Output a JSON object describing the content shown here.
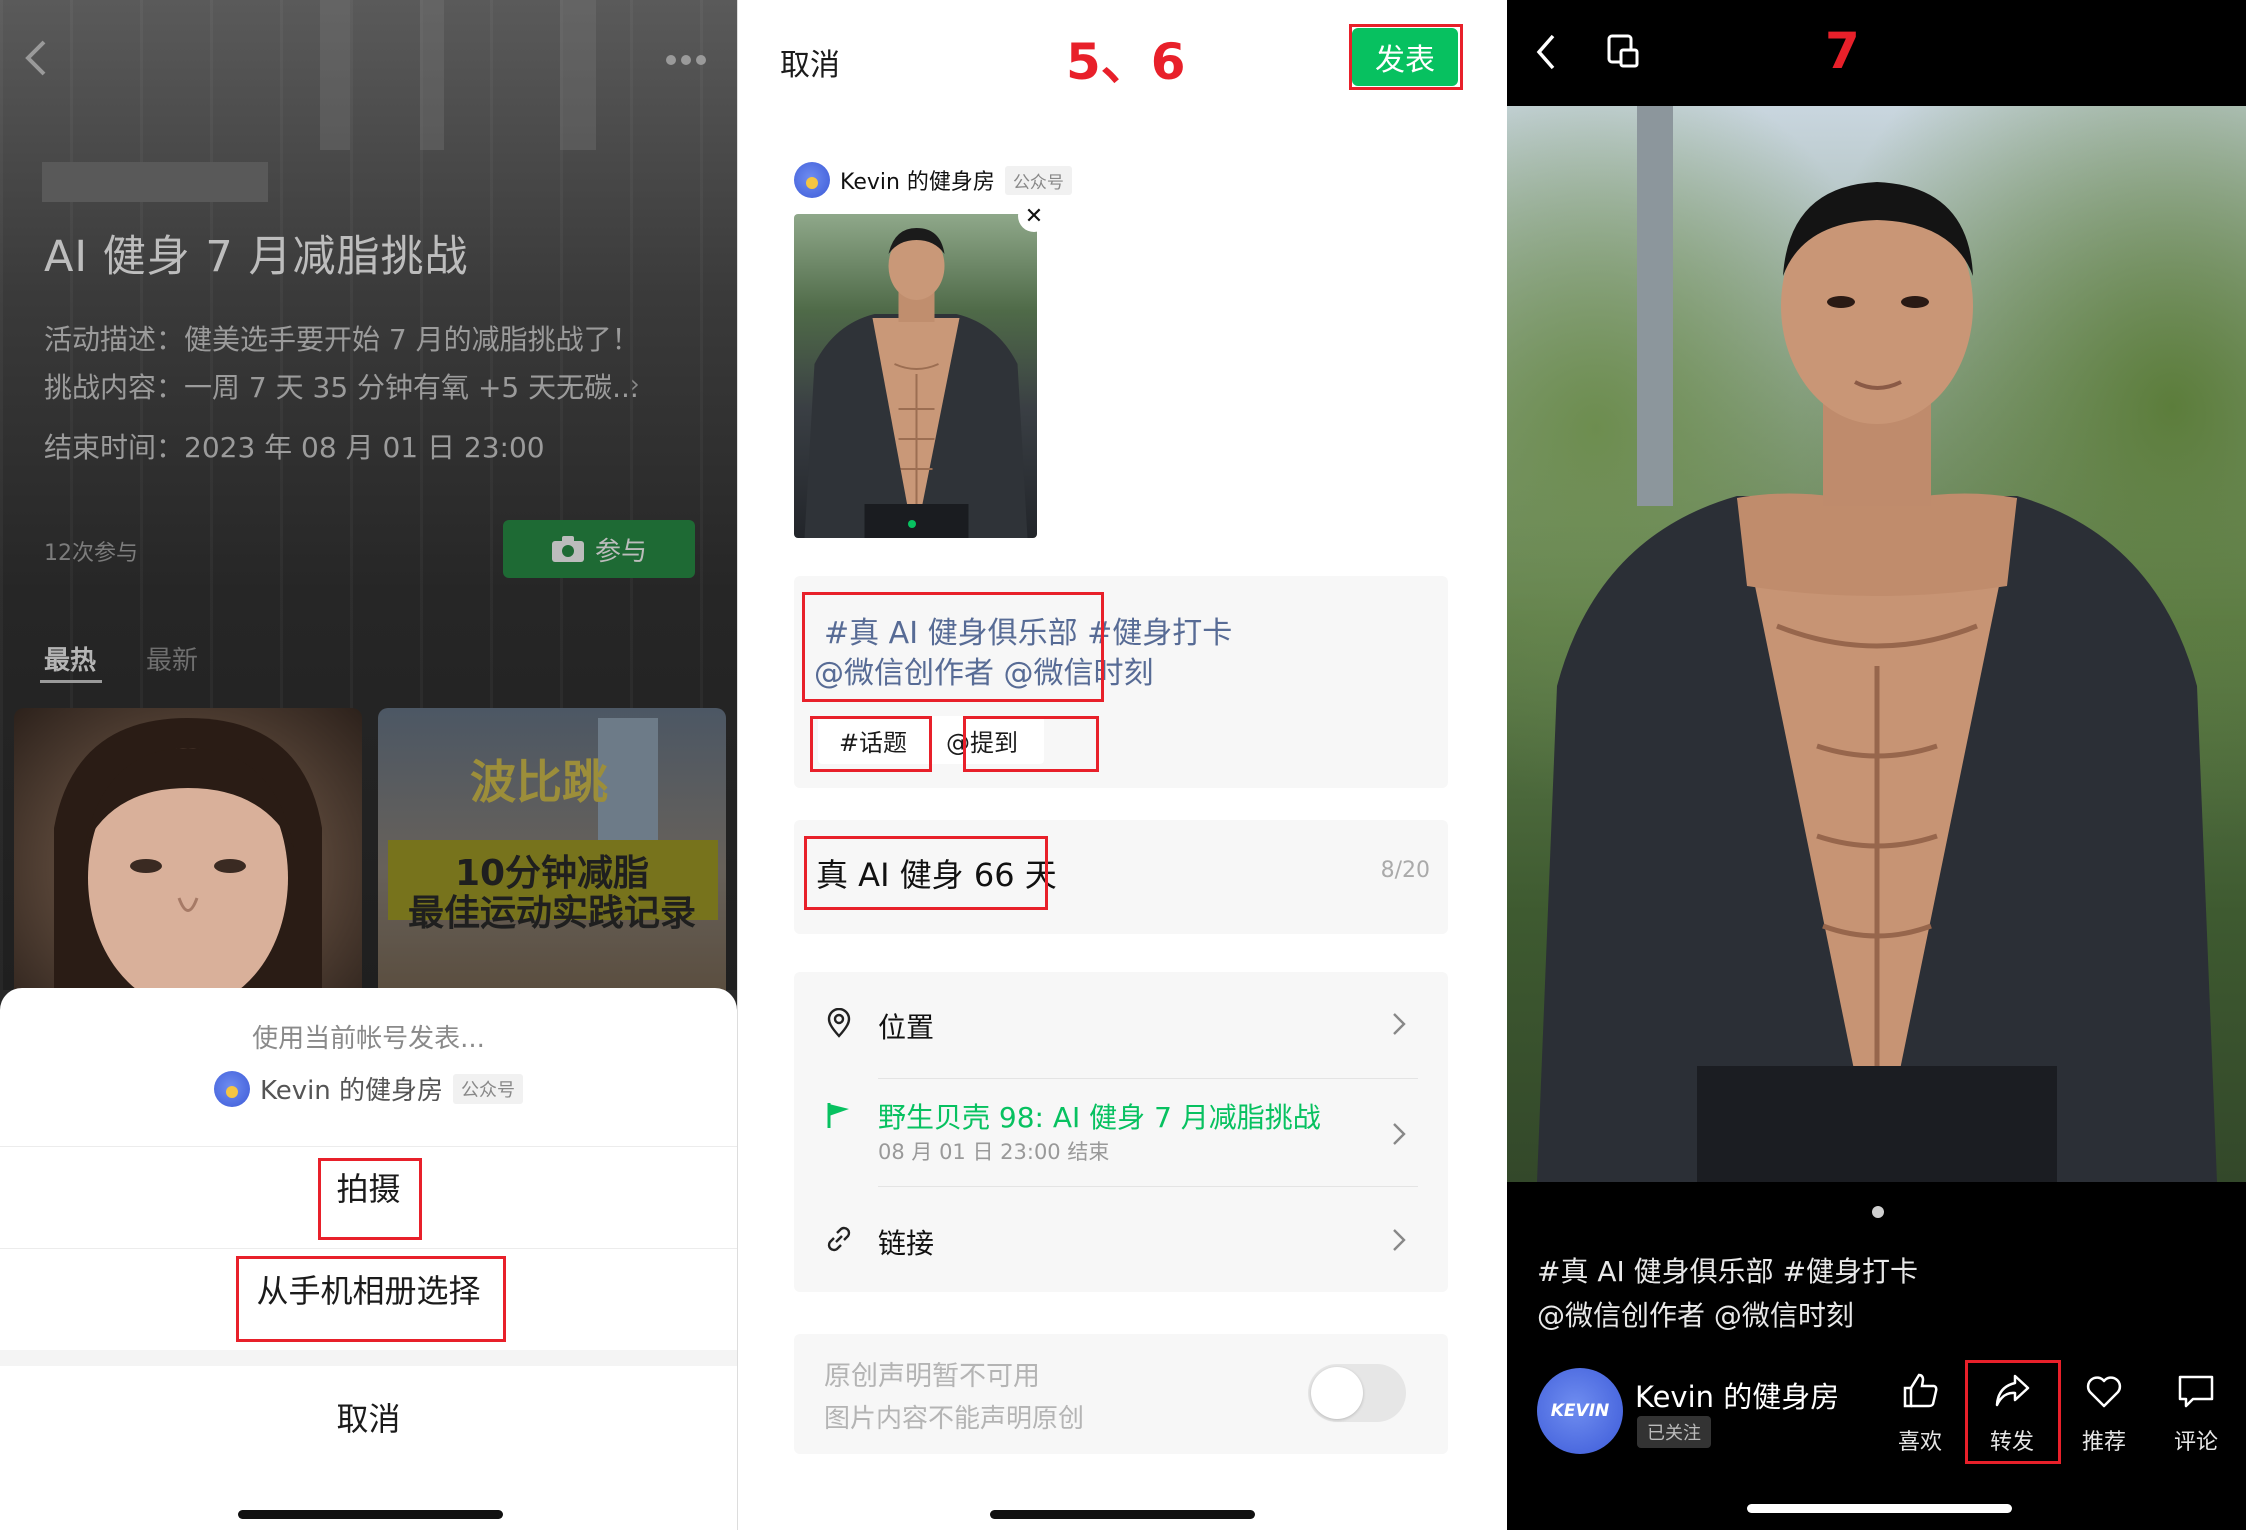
{
  "panel1": {
    "activity_title": "AI 健身 7 月减脂挑战",
    "description_line": "活动描述：健美选手要开始 7 月的减脂挑战了！",
    "challenge_line": "挑战内容：一周 7 天 35 分钟有氧 +5 天无碳...",
    "end_time_line": "结束时间：2023 年 08 月 01 日 23:00",
    "participation_count": "12次参与",
    "join_label": "参与",
    "tabs": [
      "最热",
      "最新"
    ],
    "thumb2_title": "波比跳",
    "thumb2_line1": "10分钟减脂",
    "thumb2_line2": "最佳运动实践记录",
    "sheet": {
      "title": "使用当前帐号发表...",
      "account_name": "Kevin 的健身房",
      "account_badge": "公众号",
      "options": [
        "拍摄",
        "从手机相册选择"
      ],
      "cancel": "取消"
    }
  },
  "panel2": {
    "cancel": "取消",
    "step_label": "5、6",
    "publish": "发表",
    "account_name": "Kevin 的健身房",
    "account_badge": "公众号",
    "caption_line1": "#真 AI 健身俱乐部 #健身打卡",
    "caption_line2": "@微信创作者 @微信时刻",
    "chip_topic": "#话题",
    "chip_mention": "@提到",
    "title": "真 AI 健身 66 天",
    "title_counter": "8/20",
    "location_label": "位置",
    "activity_label": "野生贝壳 98: AI 健身 7 月减脂挑战",
    "activity_sub": "08 月 01 日 23:00 结束",
    "link_label": "链接",
    "original_line1": "原创声明暂不可用",
    "original_line2": "图片内容不能声明原创",
    "accent_green": "#07c160"
  },
  "panel3": {
    "step_label": "7",
    "caption_line1": "#真 AI 健身俱乐部 #健身打卡",
    "caption_line2": "@微信创作者 @微信时刻",
    "avatar_text": "KEVIN",
    "account_name": "Kevin 的健身房",
    "follow_status": "已关注",
    "actions": [
      "喜欢",
      "转发",
      "推荐",
      "评论"
    ]
  },
  "highlight_color": "#e8202a"
}
